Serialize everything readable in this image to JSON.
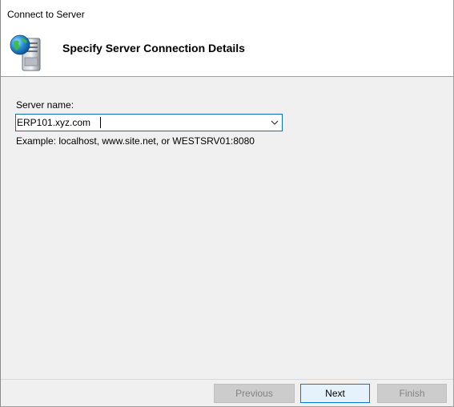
{
  "window": {
    "title": "Connect to Server"
  },
  "header": {
    "title": "Specify Server Connection Details",
    "icon": "server-globe-icon"
  },
  "form": {
    "server_label": "Server name:",
    "server_value": "ERP101.xyz.com",
    "example_text": "Example: localhost, www.site.net, or WESTSRV01:8080"
  },
  "footer": {
    "previous_label": "Previous",
    "next_label": "Next",
    "finish_label": "Finish"
  },
  "colors": {
    "accent": "#0078d7",
    "dialog_bg": "#f0f0f0",
    "header_bg": "#ffffff"
  }
}
